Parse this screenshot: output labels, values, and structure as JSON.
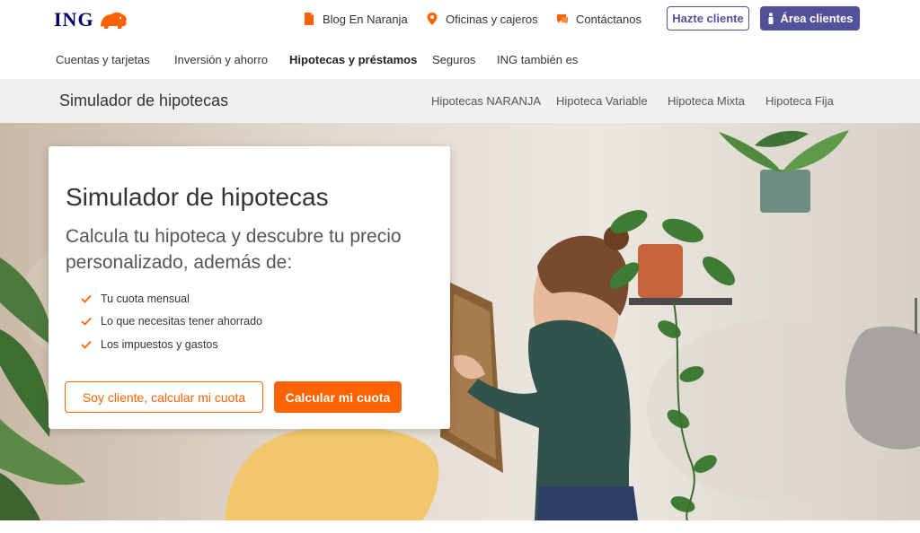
{
  "brand": {
    "logo_text": "ING",
    "orange": "#ff6200",
    "indigo": "#525199",
    "navy": "#000066"
  },
  "topbar": {
    "links": [
      {
        "label": "Blog En Naranja",
        "icon": "document-icon"
      },
      {
        "label": "Oficinas y cajeros",
        "icon": "map-pin-icon"
      },
      {
        "label": "Contáctanos",
        "icon": "chat-icon"
      }
    ],
    "signup_label": "Hazte cliente",
    "clients_label": "Área clientes",
    "clients_icon": "person-icon"
  },
  "nav": {
    "items": [
      {
        "label": "Cuentas y tarjetas"
      },
      {
        "label": "Inversión y ahorro"
      },
      {
        "label": "Hipotecas y préstamos",
        "active": true
      },
      {
        "label": "Seguros"
      },
      {
        "label": "ING también es"
      }
    ]
  },
  "subnav": {
    "title": "Simulador de hipotecas",
    "items": [
      {
        "label": "Hipotecas NARANJA"
      },
      {
        "label": "Hipoteca Variable"
      },
      {
        "label": "Hipoteca Mixta"
      },
      {
        "label": "Hipoteca Fija"
      }
    ]
  },
  "hero": {
    "title": "Simulador de hipotecas",
    "subtitle": "Calcula tu hipoteca y descubre tu precio personalizado, además de:",
    "bullets": [
      "Tu cuota mensual",
      "Lo que necesitas tener ahorrado",
      "Los impuestos y gastos"
    ],
    "client_button": "Soy cliente, calcular mi cuota",
    "calc_button": "Calcular mi cuota"
  }
}
